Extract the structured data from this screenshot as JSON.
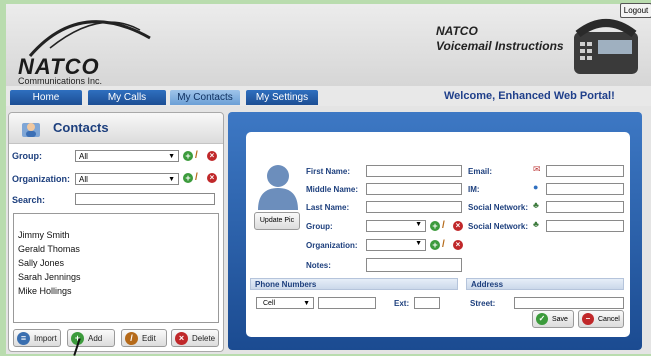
{
  "header": {
    "logo_text": "NATCO",
    "logo_sub": "Communications Inc.",
    "vm_line1": "NATCO",
    "vm_line2": "Voicemail Instructions"
  },
  "nav": {
    "tabs": [
      {
        "label": "Home"
      },
      {
        "label": "My Calls"
      },
      {
        "label": "My Contacts"
      },
      {
        "label": "My Settings"
      }
    ],
    "welcome": "Welcome, Enhanced Web Portal!",
    "logout": "Logout"
  },
  "contacts": {
    "title": "Contacts",
    "group_label": "Group:",
    "group_value": "All",
    "org_label": "Organization:",
    "org_value": "All",
    "search_label": "Search:",
    "items": [
      "Jimmy Smith",
      "Gerald Thomas",
      "Sally Jones",
      "Sarah Jennings",
      "Mike Hollings"
    ],
    "buttons": {
      "import": "Import",
      "add": "Add",
      "edit": "Edit",
      "delete": "Delete"
    }
  },
  "form": {
    "first_name": "First Name:",
    "middle_name": "Middle Name:",
    "last_name": "Last Name:",
    "group": "Group:",
    "organization": "Organization:",
    "notes": "Notes:",
    "email": "Email:",
    "im": "IM:",
    "social1": "Social Network:",
    "social2": "Social Network:",
    "update_pic": "Update Pic",
    "phone_numbers": "Phone Numbers",
    "address": "Address",
    "cell": "Cell",
    "ext": "Ext:",
    "street": "Street:",
    "save": "Save",
    "cancel": "Cancel"
  },
  "colors": {
    "accent": "#1d3f7d",
    "tab": "#1c4e94",
    "panel": "#2c64ad",
    "bg": "#b9dcae"
  }
}
